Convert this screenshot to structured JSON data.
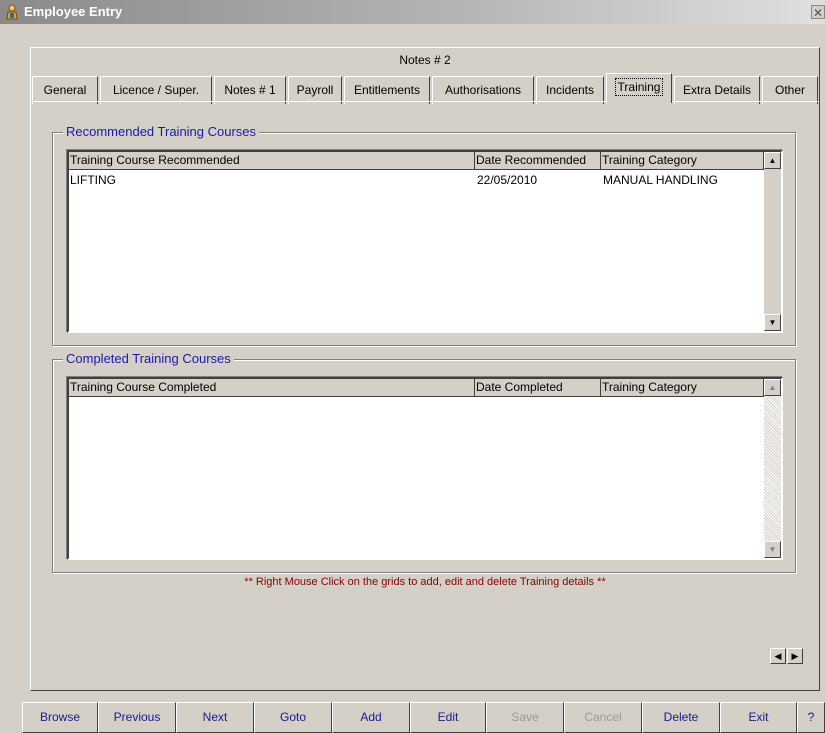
{
  "window": {
    "title": "Employee Entry",
    "close_glyph": "✕"
  },
  "tabs_top": [
    "Notes # 2"
  ],
  "tabs": [
    {
      "label": "General"
    },
    {
      "label": "Licence / Super."
    },
    {
      "label": "Notes # 1"
    },
    {
      "label": "Payroll"
    },
    {
      "label": "Entitlements"
    },
    {
      "label": "Authorisations"
    },
    {
      "label": "Incidents"
    },
    {
      "label": "Training",
      "active": true
    },
    {
      "label": "Extra Details"
    },
    {
      "label": "Other"
    }
  ],
  "recommended": {
    "legend": "Recommended Training Courses",
    "columns": [
      "Training Course Recommended",
      "Date Recommended",
      "Training Category"
    ],
    "rows": [
      [
        "LIFTING",
        "22/05/2010",
        "MANUAL HANDLING"
      ]
    ]
  },
  "completed": {
    "legend": "Completed Training Courses",
    "columns": [
      "Training Course Completed",
      "Date Completed",
      "Training Category"
    ],
    "rows": []
  },
  "note": "** Right Mouse Click on the grids to add, edit and delete Training details **",
  "toolbar": {
    "browse": "Browse",
    "previous": "Previous",
    "next": "Next",
    "goto": "Goto",
    "add": "Add",
    "edit": "Edit",
    "save": "Save",
    "cancel": "Cancel",
    "delete": "Delete",
    "exit": "Exit",
    "help": "?"
  },
  "colors": {
    "accent_text": "#1a1aa6",
    "note_text": "#8b0000",
    "face": "#d4d0c8"
  }
}
